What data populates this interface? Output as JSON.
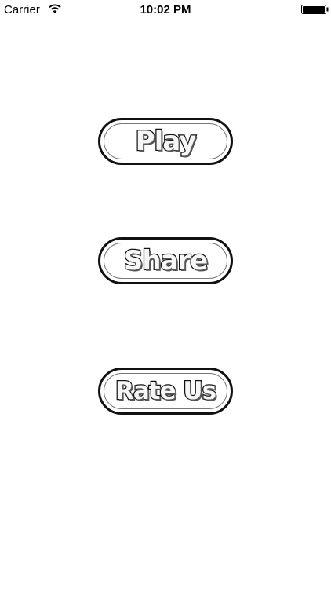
{
  "status_bar": {
    "carrier": "Carrier",
    "time": "10:02 PM",
    "wifi_icon": "wifi-icon",
    "battery_icon": "battery-icon"
  },
  "menu": {
    "play_label": "Play",
    "share_label": "Share",
    "rate_label": "Rate Us"
  },
  "colors": {
    "background": "#ffffff",
    "outline": "#111111",
    "button_fill": "#ffffff",
    "text_fill": "#f6f6f6"
  }
}
